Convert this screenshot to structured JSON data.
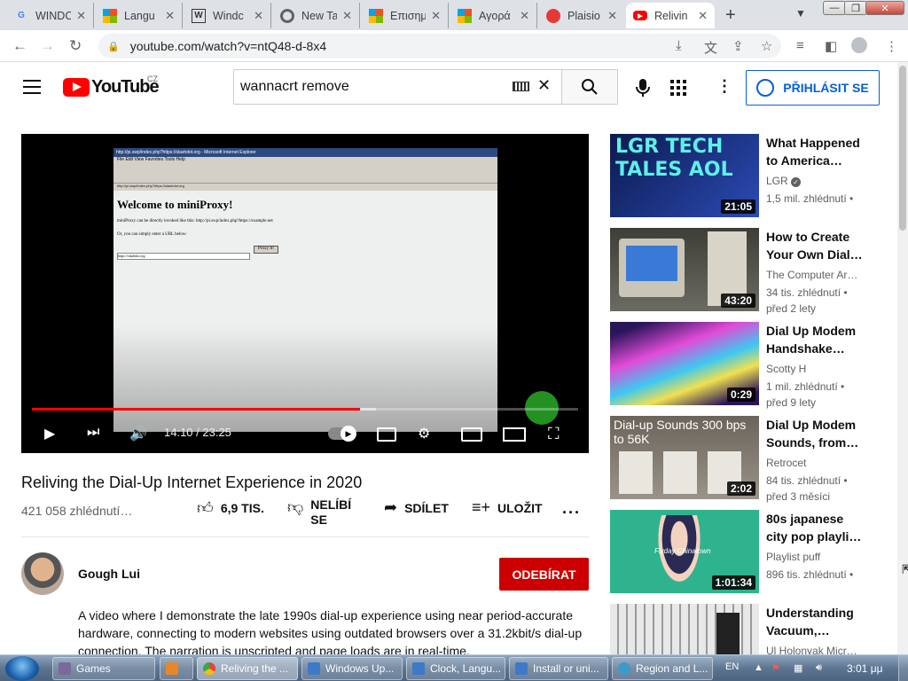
{
  "browser": {
    "tabs": [
      {
        "title": "WINDC",
        "icon": "google-icon"
      },
      {
        "title": "Langu",
        "icon": "windows-icon"
      },
      {
        "title": "Windc",
        "icon": "wiki-icon"
      },
      {
        "title": "New Ta",
        "icon": "chrome-icon"
      },
      {
        "title": "Επισημ",
        "icon": "windows-icon"
      },
      {
        "title": "Αγορά",
        "icon": "windows-icon"
      },
      {
        "title": "Plaisio",
        "icon": "red-circle-icon"
      },
      {
        "title": "Relivin",
        "icon": "youtube-icon"
      }
    ],
    "new_tab": "+",
    "url": "youtube.com/watch?v=ntQ48-d-8x4"
  },
  "youtube": {
    "logo_text": "YouTube",
    "country_code": "CZ",
    "search_value": "wannacrt remove",
    "sign_in": "PŘIHLÁSIT SE"
  },
  "player": {
    "screen_title": "http://pi.swp/index.php?https://slashdot.org - Microsoft Internet Explorer",
    "screen_menus": "File   Edit   View   Favorites   Tools   Help",
    "screen_address": "http://pi.swp/index.php?https://slashdot.org",
    "page_heading": "Welcome to miniProxy!",
    "page_line1": "miniProxy can be directly invoked like this: http://pi.swp/index.php?https://example.net",
    "page_line2": "Or, you can simply enter a URL below:",
    "page_input": "https://slashdot.org",
    "page_button": "Proxy It!",
    "time": "14:10 / 23:25",
    "progress": 0.6,
    "buffered": 0.63
  },
  "video": {
    "title": "Reliving the Dial-Up Internet Experience in 2020",
    "views": "421 058 zhlédnutí…",
    "likes": "6,9 TIS.",
    "dislike": "NELÍBÍ SE",
    "share": "SDÍLET",
    "save": "ULOŽIT",
    "more": "···",
    "channel": "Gough Lui",
    "subscribe": "ODEBÍRAT",
    "description": "A video where I demonstrate the late 1990s dial-up experience using near period-accurate hardware, connecting to modern websites using outdated browsers over a 31.2kbit/s dial-up connection. The narration is unscripted and page loads are in real-time."
  },
  "recommendations": [
    {
      "title": "What Happened to America…",
      "channel": "LGR",
      "meta": "1,5 mil. zhlédnutí •",
      "duration": "21:05",
      "thumb_text": "LGR TECH TALES AOL",
      "thumb_color": "#1b2f7a"
    },
    {
      "title": "How to Create Your Own Dial…",
      "channel": "The Computer Ar…",
      "meta": "34 tis. zhlédnutí • před 2 lety",
      "duration": "43:20",
      "thumb_text": "",
      "thumb_color": "#5a5a52"
    },
    {
      "title": "Dial Up Modem Handshake…",
      "channel": "Scotty H",
      "meta": "1 mil. zhlédnutí • před 9 lety",
      "duration": "0:29",
      "thumb_text": "",
      "thumb_color": "#5a2d8a"
    },
    {
      "title": "Dial Up Modem Sounds, from…",
      "channel": "Retrocet",
      "meta": "84 tis. zhlédnutí • před 3 měsíci",
      "duration": "2:02",
      "thumb_text": "Dial-up Sounds   300 bps to 56K",
      "thumb_color": "#5d574f"
    },
    {
      "title": "80s japanese city pop playli…",
      "channel": "Playlist puff",
      "meta": "896 tis. zhlédnutí •",
      "duration": "1:01:34",
      "thumb_text": "Flyday Chinatown",
      "thumb_color": "#2fb38e"
    },
    {
      "title": "Understanding Vacuum,…",
      "channel": "Ul Holonyak Micr…",
      "meta": "",
      "duration": "",
      "thumb_text": "",
      "thumb_color": "#d9d9d9"
    }
  ],
  "taskbar": {
    "items": [
      "Games",
      "",
      "Reliving the ...",
      "Windows Up...",
      "Clock, Langu...",
      "Install or uni...",
      "Region and L..."
    ],
    "lang": "EN",
    "clock": "3:01 μμ"
  }
}
